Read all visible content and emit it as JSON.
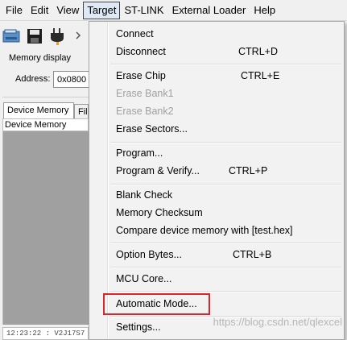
{
  "menubar": {
    "items": [
      {
        "label": "File"
      },
      {
        "label": "Edit"
      },
      {
        "label": "View"
      },
      {
        "label": "Target"
      },
      {
        "label": "ST-LINK"
      },
      {
        "label": "External Loader"
      },
      {
        "label": "Help"
      }
    ],
    "active_index": 3
  },
  "toolbar": {
    "icons": [
      "open-file-icon",
      "save-icon",
      "connect-plug-icon",
      "disconnect-icon"
    ]
  },
  "memory": {
    "display_label": "Memory display",
    "address_label": "Address:",
    "address_value": "0x0800"
  },
  "tabs": [
    {
      "label": "Device Memory"
    },
    {
      "label": "File"
    }
  ],
  "panel": {
    "title": "Device Memory"
  },
  "log": {
    "line": "12:23:22 : V2J17S7"
  },
  "target_menu": {
    "items": [
      {
        "label": "Connect",
        "shortcut": "",
        "enabled": true
      },
      {
        "label": "Disconnect",
        "shortcut": "CTRL+D",
        "enabled": true
      },
      {
        "label": "Erase Chip",
        "shortcut": "CTRL+E",
        "enabled": true
      },
      {
        "label": "Erase Bank1",
        "shortcut": "",
        "enabled": false
      },
      {
        "label": "Erase Bank2",
        "shortcut": "",
        "enabled": false
      },
      {
        "label": "Erase Sectors...",
        "shortcut": "",
        "enabled": true
      },
      {
        "label": "Program...",
        "shortcut": "",
        "enabled": true
      },
      {
        "label": "Program & Verify...",
        "shortcut": "CTRL+P",
        "enabled": true
      },
      {
        "label": "Blank Check",
        "shortcut": "",
        "enabled": true
      },
      {
        "label": "Memory Checksum",
        "shortcut": "",
        "enabled": true
      },
      {
        "label": "Compare device memory with [test.hex]",
        "shortcut": "",
        "enabled": true
      },
      {
        "label": "Option Bytes...",
        "shortcut": "CTRL+B",
        "enabled": true
      },
      {
        "label": "MCU Core...",
        "shortcut": "",
        "enabled": true
      },
      {
        "label": "Automatic Mode...",
        "shortcut": "",
        "enabled": true,
        "highlighted": true
      },
      {
        "label": "Settings...",
        "shortcut": "",
        "enabled": true
      }
    ],
    "highlight_color": "#d9262c"
  },
  "watermark": {
    "text": "https://blog.csdn.net/qlexcel"
  }
}
